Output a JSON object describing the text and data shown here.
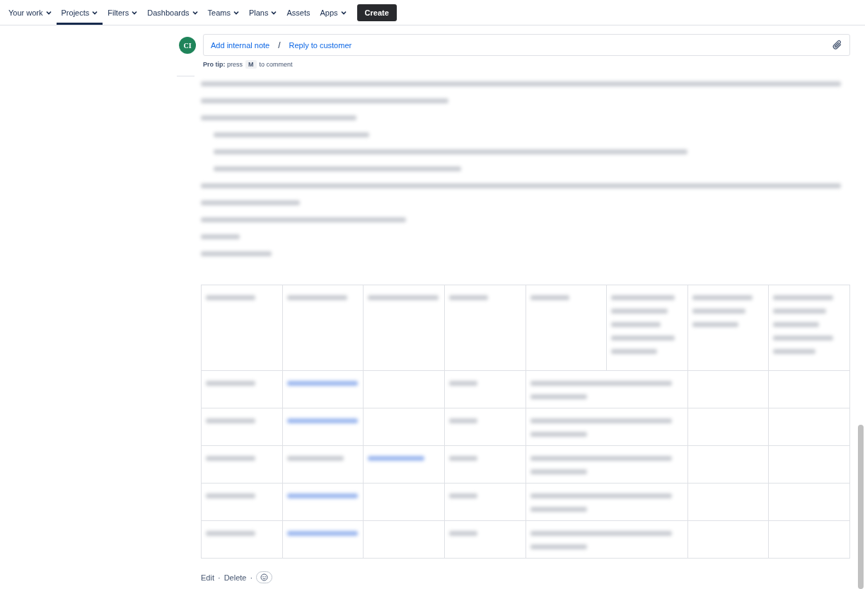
{
  "nav": {
    "items": [
      {
        "label": "Your work",
        "menu": true,
        "selected": false
      },
      {
        "label": "Projects",
        "menu": true,
        "selected": true
      },
      {
        "label": "Filters",
        "menu": true,
        "selected": false
      },
      {
        "label": "Dashboards",
        "menu": true,
        "selected": false
      },
      {
        "label": "Teams",
        "menu": true,
        "selected": false
      },
      {
        "label": "Plans",
        "menu": true,
        "selected": false
      },
      {
        "label": "Assets",
        "menu": false,
        "selected": false
      },
      {
        "label": "Apps",
        "menu": true,
        "selected": false
      }
    ],
    "create": "Create"
  },
  "comment": {
    "avatar": "CI",
    "actions": [
      "Add internal note",
      "Reply to customer"
    ],
    "separator": "/",
    "tip_before": "**Pro tip:** press",
    "tip_key": "M",
    "tip_after": "to comment"
  },
  "footer": {
    "actions": [
      "Edit",
      "Delete"
    ],
    "separator": "·"
  }
}
